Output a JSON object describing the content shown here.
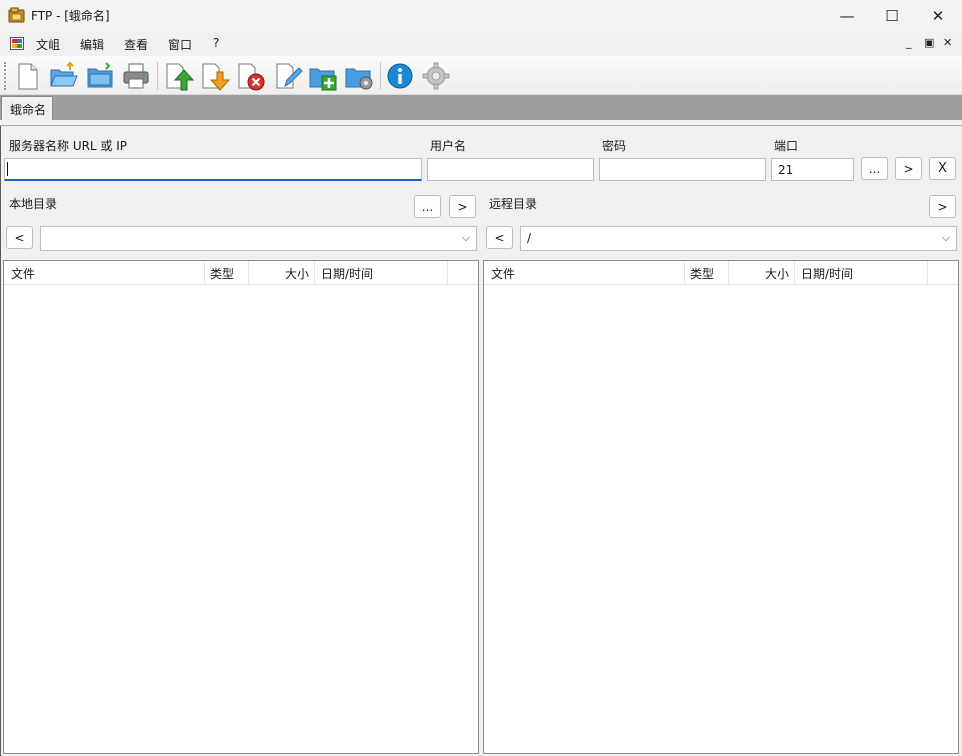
{
  "window": {
    "title": "FTP - [蛾命名]",
    "controls": {
      "minimize": "—",
      "maximize": "☐",
      "close": "✕"
    }
  },
  "menu": {
    "items": [
      {
        "label": "文岨"
      },
      {
        "label": "编辑"
      },
      {
        "label": "查看"
      },
      {
        "label": "窗口"
      },
      {
        "label": "?"
      }
    ],
    "mdi": {
      "minimize": "_",
      "restore": "▣",
      "close": "✕"
    }
  },
  "toolbar": {
    "buttons": [
      {
        "icon": "new-document-icon"
      },
      {
        "icon": "open-folder-icon"
      },
      {
        "icon": "save-icon"
      },
      {
        "icon": "print-icon"
      },
      {
        "icon": "upload-icon"
      },
      {
        "icon": "download-icon"
      },
      {
        "icon": "delete-icon"
      },
      {
        "icon": "rename-icon"
      },
      {
        "icon": "new-folder-icon"
      },
      {
        "icon": "folder-settings-icon"
      },
      {
        "icon": "info-icon"
      },
      {
        "icon": "settings-gear-icon"
      }
    ]
  },
  "tabs": [
    {
      "label": "蛾命名",
      "active": true
    }
  ],
  "connection": {
    "server_label": "服务器名称 URL 或 IP",
    "server_value": "",
    "user_label": "用户名",
    "user_value": "",
    "password_label": "密码",
    "password_value": "",
    "port_label": "端口",
    "port_value": "21",
    "browse_label": "...",
    "connect_label": ">",
    "disconnect_label": "X"
  },
  "local": {
    "label": "本地目录",
    "browse_label": "...",
    "go_label": ">",
    "back_label": "<",
    "path": "",
    "columns": [
      "文件",
      "类型",
      "大小",
      "日期/时间"
    ]
  },
  "remote": {
    "label": "远程目录",
    "go_label": ">",
    "back_label": "<",
    "path": "/",
    "columns": [
      "文件",
      "类型",
      "大小",
      "日期/时间"
    ]
  },
  "colors": {
    "accent": "#1f5fbf",
    "tab_strip": "#9e9e9e",
    "info_blue": "#1a8ad4",
    "upload_green": "#3aa63a",
    "download_orange": "#f0a020",
    "delete_red": "#d9302c"
  }
}
